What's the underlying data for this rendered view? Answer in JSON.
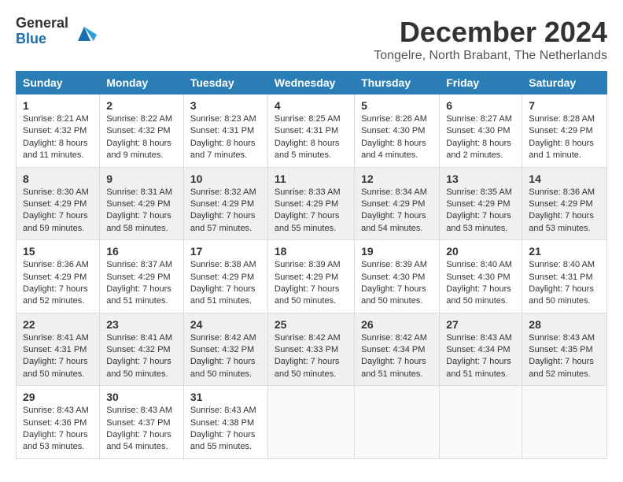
{
  "logo": {
    "general": "General",
    "blue": "Blue"
  },
  "title": "December 2024",
  "subtitle": "Tongelre, North Brabant, The Netherlands",
  "headers": [
    "Sunday",
    "Monday",
    "Tuesday",
    "Wednesday",
    "Thursday",
    "Friday",
    "Saturday"
  ],
  "weeks": [
    [
      {
        "day": "1",
        "sunrise": "Sunrise: 8:21 AM",
        "sunset": "Sunset: 4:32 PM",
        "daylight": "Daylight: 8 hours and 11 minutes."
      },
      {
        "day": "2",
        "sunrise": "Sunrise: 8:22 AM",
        "sunset": "Sunset: 4:32 PM",
        "daylight": "Daylight: 8 hours and 9 minutes."
      },
      {
        "day": "3",
        "sunrise": "Sunrise: 8:23 AM",
        "sunset": "Sunset: 4:31 PM",
        "daylight": "Daylight: 8 hours and 7 minutes."
      },
      {
        "day": "4",
        "sunrise": "Sunrise: 8:25 AM",
        "sunset": "Sunset: 4:31 PM",
        "daylight": "Daylight: 8 hours and 5 minutes."
      },
      {
        "day": "5",
        "sunrise": "Sunrise: 8:26 AM",
        "sunset": "Sunset: 4:30 PM",
        "daylight": "Daylight: 8 hours and 4 minutes."
      },
      {
        "day": "6",
        "sunrise": "Sunrise: 8:27 AM",
        "sunset": "Sunset: 4:30 PM",
        "daylight": "Daylight: 8 hours and 2 minutes."
      },
      {
        "day": "7",
        "sunrise": "Sunrise: 8:28 AM",
        "sunset": "Sunset: 4:29 PM",
        "daylight": "Daylight: 8 hours and 1 minute."
      }
    ],
    [
      {
        "day": "8",
        "sunrise": "Sunrise: 8:30 AM",
        "sunset": "Sunset: 4:29 PM",
        "daylight": "Daylight: 7 hours and 59 minutes."
      },
      {
        "day": "9",
        "sunrise": "Sunrise: 8:31 AM",
        "sunset": "Sunset: 4:29 PM",
        "daylight": "Daylight: 7 hours and 58 minutes."
      },
      {
        "day": "10",
        "sunrise": "Sunrise: 8:32 AM",
        "sunset": "Sunset: 4:29 PM",
        "daylight": "Daylight: 7 hours and 57 minutes."
      },
      {
        "day": "11",
        "sunrise": "Sunrise: 8:33 AM",
        "sunset": "Sunset: 4:29 PM",
        "daylight": "Daylight: 7 hours and 55 minutes."
      },
      {
        "day": "12",
        "sunrise": "Sunrise: 8:34 AM",
        "sunset": "Sunset: 4:29 PM",
        "daylight": "Daylight: 7 hours and 54 minutes."
      },
      {
        "day": "13",
        "sunrise": "Sunrise: 8:35 AM",
        "sunset": "Sunset: 4:29 PM",
        "daylight": "Daylight: 7 hours and 53 minutes."
      },
      {
        "day": "14",
        "sunrise": "Sunrise: 8:36 AM",
        "sunset": "Sunset: 4:29 PM",
        "daylight": "Daylight: 7 hours and 53 minutes."
      }
    ],
    [
      {
        "day": "15",
        "sunrise": "Sunrise: 8:36 AM",
        "sunset": "Sunset: 4:29 PM",
        "daylight": "Daylight: 7 hours and 52 minutes."
      },
      {
        "day": "16",
        "sunrise": "Sunrise: 8:37 AM",
        "sunset": "Sunset: 4:29 PM",
        "daylight": "Daylight: 7 hours and 51 minutes."
      },
      {
        "day": "17",
        "sunrise": "Sunrise: 8:38 AM",
        "sunset": "Sunset: 4:29 PM",
        "daylight": "Daylight: 7 hours and 51 minutes."
      },
      {
        "day": "18",
        "sunrise": "Sunrise: 8:39 AM",
        "sunset": "Sunset: 4:29 PM",
        "daylight": "Daylight: 7 hours and 50 minutes."
      },
      {
        "day": "19",
        "sunrise": "Sunrise: 8:39 AM",
        "sunset": "Sunset: 4:30 PM",
        "daylight": "Daylight: 7 hours and 50 minutes."
      },
      {
        "day": "20",
        "sunrise": "Sunrise: 8:40 AM",
        "sunset": "Sunset: 4:30 PM",
        "daylight": "Daylight: 7 hours and 50 minutes."
      },
      {
        "day": "21",
        "sunrise": "Sunrise: 8:40 AM",
        "sunset": "Sunset: 4:31 PM",
        "daylight": "Daylight: 7 hours and 50 minutes."
      }
    ],
    [
      {
        "day": "22",
        "sunrise": "Sunrise: 8:41 AM",
        "sunset": "Sunset: 4:31 PM",
        "daylight": "Daylight: 7 hours and 50 minutes."
      },
      {
        "day": "23",
        "sunrise": "Sunrise: 8:41 AM",
        "sunset": "Sunset: 4:32 PM",
        "daylight": "Daylight: 7 hours and 50 minutes."
      },
      {
        "day": "24",
        "sunrise": "Sunrise: 8:42 AM",
        "sunset": "Sunset: 4:32 PM",
        "daylight": "Daylight: 7 hours and 50 minutes."
      },
      {
        "day": "25",
        "sunrise": "Sunrise: 8:42 AM",
        "sunset": "Sunset: 4:33 PM",
        "daylight": "Daylight: 7 hours and 50 minutes."
      },
      {
        "day": "26",
        "sunrise": "Sunrise: 8:42 AM",
        "sunset": "Sunset: 4:34 PM",
        "daylight": "Daylight: 7 hours and 51 minutes."
      },
      {
        "day": "27",
        "sunrise": "Sunrise: 8:43 AM",
        "sunset": "Sunset: 4:34 PM",
        "daylight": "Daylight: 7 hours and 51 minutes."
      },
      {
        "day": "28",
        "sunrise": "Sunrise: 8:43 AM",
        "sunset": "Sunset: 4:35 PM",
        "daylight": "Daylight: 7 hours and 52 minutes."
      }
    ],
    [
      {
        "day": "29",
        "sunrise": "Sunrise: 8:43 AM",
        "sunset": "Sunset: 4:36 PM",
        "daylight": "Daylight: 7 hours and 53 minutes."
      },
      {
        "day": "30",
        "sunrise": "Sunrise: 8:43 AM",
        "sunset": "Sunset: 4:37 PM",
        "daylight": "Daylight: 7 hours and 54 minutes."
      },
      {
        "day": "31",
        "sunrise": "Sunrise: 8:43 AM",
        "sunset": "Sunset: 4:38 PM",
        "daylight": "Daylight: 7 hours and 55 minutes."
      },
      null,
      null,
      null,
      null
    ]
  ]
}
